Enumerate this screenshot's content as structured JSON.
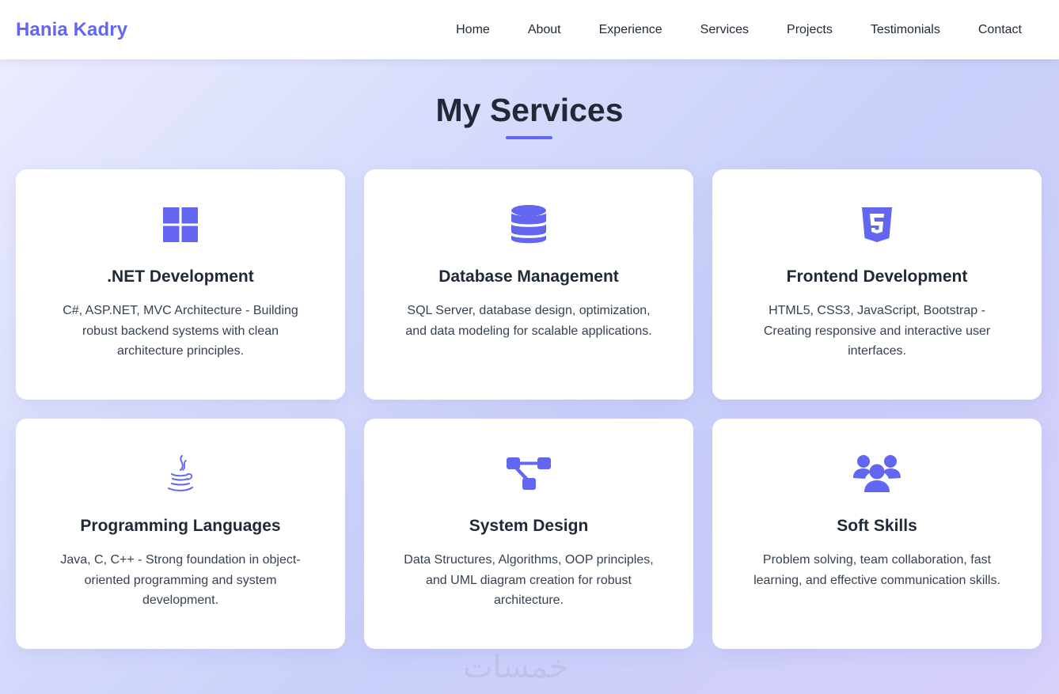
{
  "brand": {
    "name": "Hania Kadry",
    "color": "#6366f1"
  },
  "nav": {
    "items": [
      {
        "label": "Home"
      },
      {
        "label": "About"
      },
      {
        "label": "Experience"
      },
      {
        "label": "Services"
      },
      {
        "label": "Projects"
      },
      {
        "label": "Testimonials"
      },
      {
        "label": "Contact"
      }
    ]
  },
  "services": {
    "title": "My Services",
    "cards": [
      {
        "icon": "windows-icon",
        "title": ".NET Development",
        "description": "C#, ASP.NET, MVC Architecture - Building robust backend systems with clean architecture principles."
      },
      {
        "icon": "database-icon",
        "title": "Database Management",
        "description": "SQL Server, database design, optimization, and data modeling for scalable applications."
      },
      {
        "icon": "html5-icon",
        "title": "Frontend Development",
        "description": "HTML5, CSS3, JavaScript, Bootstrap - Creating responsive and interactive user interfaces."
      },
      {
        "icon": "java-icon",
        "title": "Programming Languages",
        "description": "Java, C, C++ - Strong foundation in object-oriented programming and system development."
      },
      {
        "icon": "project-diagram-icon",
        "title": "System Design",
        "description": "Data Structures, Algorithms, OOP principles, and UML diagram creation for robust architecture."
      },
      {
        "icon": "users-icon",
        "title": "Soft Skills",
        "description": "Problem solving, team collaboration, fast learning, and effective communication skills."
      }
    ]
  },
  "watermark": {
    "text": "خمسات"
  },
  "colors": {
    "accent": "#6366f1",
    "heading": "#1f2937",
    "text": "#374151"
  }
}
